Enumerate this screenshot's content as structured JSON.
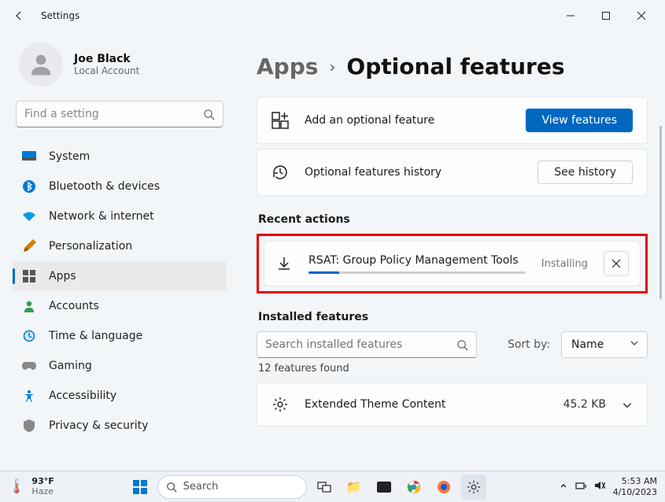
{
  "window": {
    "title": "Settings"
  },
  "user": {
    "name": "Joe Black",
    "subtitle": "Local Account"
  },
  "search": {
    "placeholder": "Find a setting"
  },
  "nav": {
    "items": [
      {
        "label": "System",
        "icon": "system"
      },
      {
        "label": "Bluetooth & devices",
        "icon": "bluetooth"
      },
      {
        "label": "Network & internet",
        "icon": "network"
      },
      {
        "label": "Personalization",
        "icon": "personalization"
      },
      {
        "label": "Apps",
        "icon": "apps",
        "selected": true
      },
      {
        "label": "Accounts",
        "icon": "accounts"
      },
      {
        "label": "Time & language",
        "icon": "time"
      },
      {
        "label": "Gaming",
        "icon": "gaming"
      },
      {
        "label": "Accessibility",
        "icon": "accessibility"
      },
      {
        "label": "Privacy & security",
        "icon": "privacy"
      }
    ]
  },
  "breadcrumb": {
    "parent": "Apps",
    "current": "Optional features"
  },
  "cards": {
    "add": {
      "label": "Add an optional feature",
      "button": "View features"
    },
    "history": {
      "label": "Optional features history",
      "button": "See history"
    }
  },
  "sections": {
    "recent": "Recent actions",
    "installed": "Installed features"
  },
  "recent_action": {
    "title": "RSAT: Group Policy Management Tools",
    "status": "Installing",
    "progress_percent": 14
  },
  "installed_filter": {
    "placeholder": "Search installed features",
    "sortby_label": "Sort by:",
    "sort_value": "Name"
  },
  "features_count": "12 features found",
  "features": [
    {
      "name": "Extended Theme Content",
      "size": "45.2 KB"
    }
  ],
  "taskbar": {
    "weather": {
      "temp": "93°F",
      "cond": "Haze"
    },
    "search": "Search",
    "time": "5:53 AM",
    "date": "4/10/2023"
  }
}
